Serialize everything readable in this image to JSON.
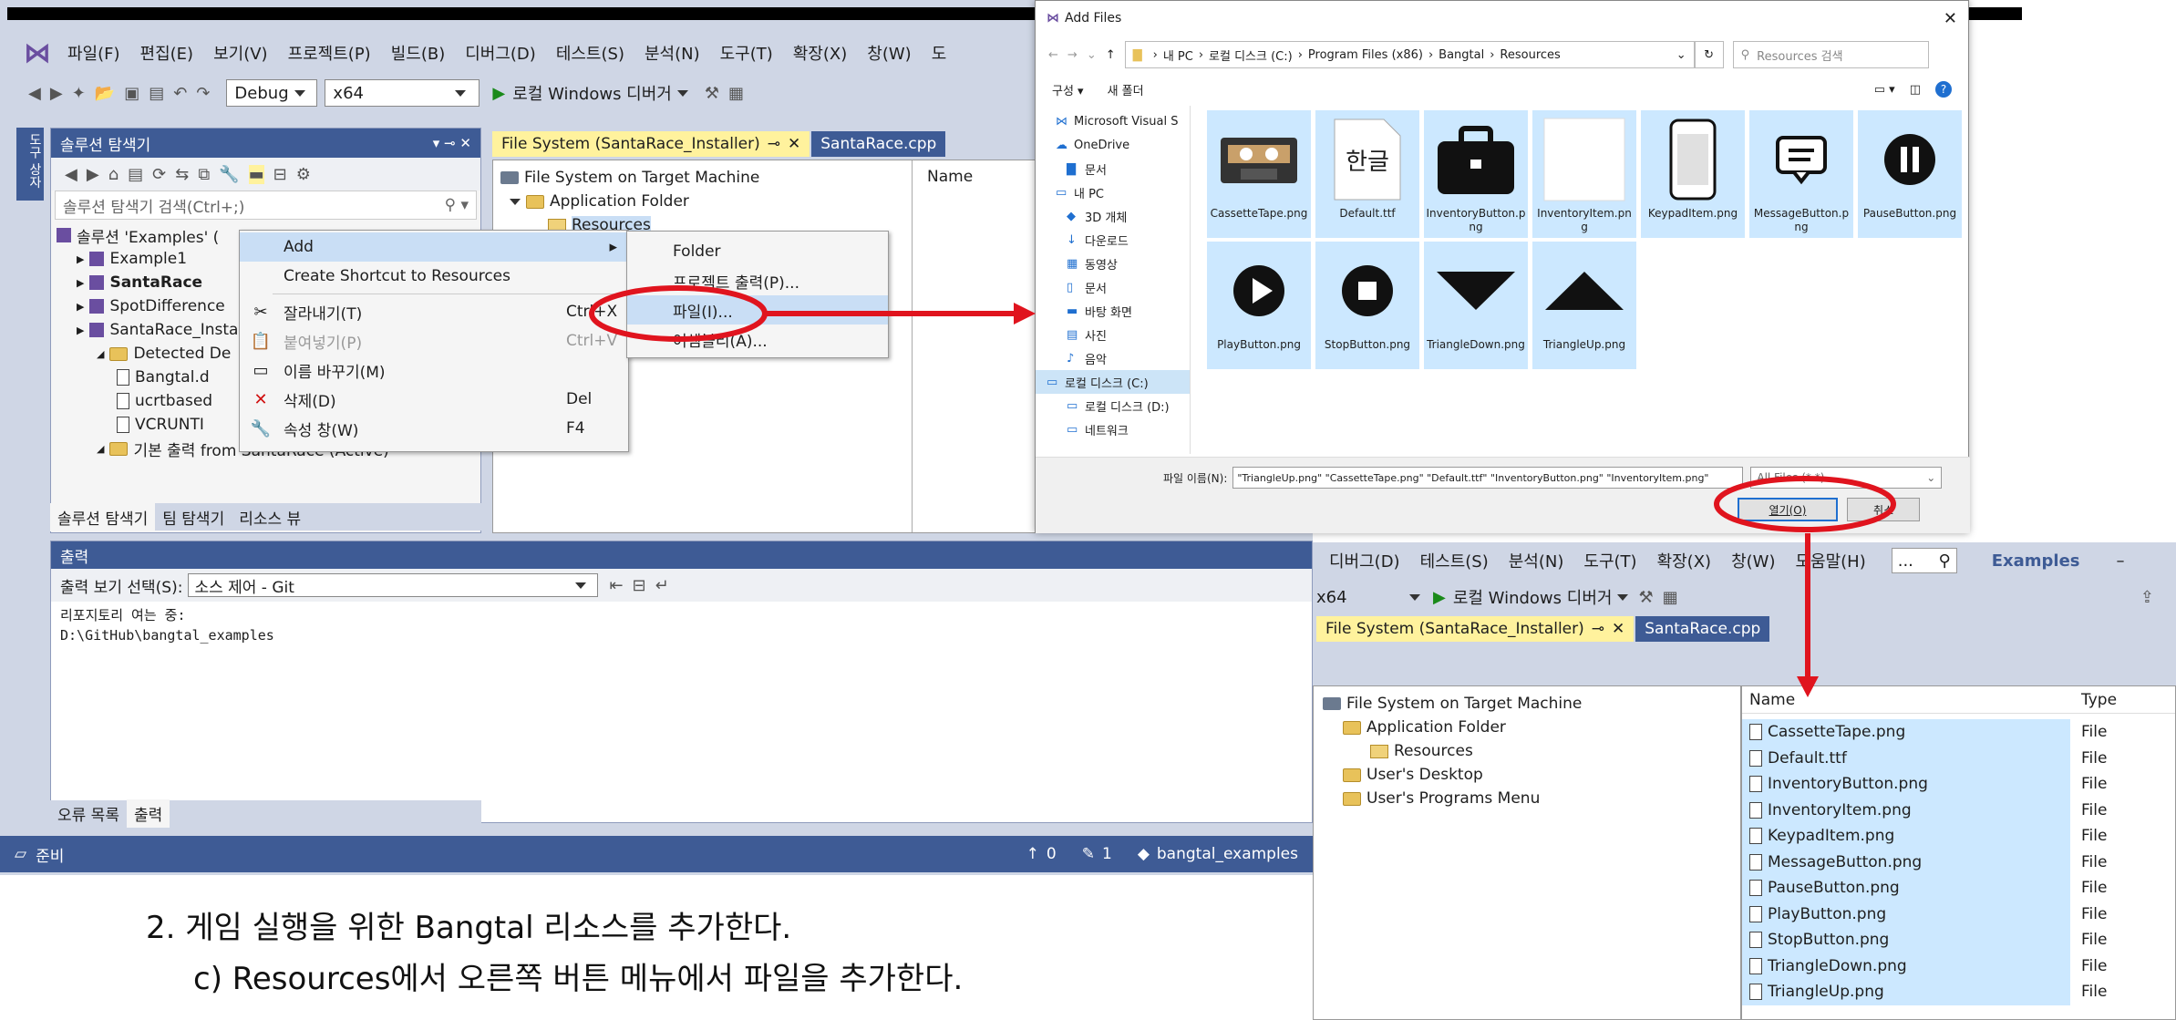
{
  "menubar": {
    "items": [
      "파일(F)",
      "편집(E)",
      "보기(V)",
      "프로젝트(P)",
      "빌드(B)",
      "디버그(D)",
      "테스트(S)",
      "분석(N)",
      "도구(T)",
      "확장(X)",
      "창(W)",
      "도"
    ]
  },
  "toolbar": {
    "config": "Debug",
    "platform": "x64",
    "run_label": "로컬 Windows 디버거"
  },
  "left_vertical_tab": "도구 상자",
  "solution_explorer": {
    "title": "솔루션 탐색기",
    "search_placeholder": "솔루션 탐색기 검색(Ctrl+;)",
    "tree": [
      {
        "label": "솔루션 'Examples' (",
        "indent": 0
      },
      {
        "label": "Example1",
        "indent": 1
      },
      {
        "label": "SantaRace",
        "indent": 1,
        "bold": true
      },
      {
        "label": "SpotDifference",
        "indent": 1
      },
      {
        "label": "SantaRace_Insta",
        "indent": 1
      },
      {
        "label": "Detected De",
        "indent": 2
      },
      {
        "label": "Bangtal.d",
        "indent": 3
      },
      {
        "label": "ucrtbased",
        "indent": 3
      },
      {
        "label": "VCRUNTI",
        "indent": 3
      },
      {
        "label": "기본 출력 from SantaRace (Active)",
        "indent": 2
      }
    ],
    "bottom_tabs": [
      "솔루션 탐색기",
      "팀 탐색기",
      "리소스 뷰"
    ]
  },
  "doc_tabs": {
    "active": "File System (SantaRace_Installer)",
    "pin": "⊸",
    "inactive": "SantaRace.cpp"
  },
  "fs_editor": {
    "tree": [
      "File System on Target Machine",
      "Application Folder",
      "Resources"
    ],
    "list_header": "Name"
  },
  "context_menu": {
    "items": [
      {
        "label": "Add",
        "shortcut": "",
        "icon": "",
        "submenu": true
      },
      {
        "label": "Create Shortcut to Resources",
        "shortcut": "",
        "icon": ""
      },
      {
        "label": "잘라내기(T)",
        "shortcut": "Ctrl+X",
        "icon": "scissors-icon"
      },
      {
        "label": "붙여넣기(P)",
        "shortcut": "Ctrl+V",
        "icon": "paste-icon"
      },
      {
        "label": "이름 바꾸기(M)",
        "shortcut": "",
        "icon": "rename-icon"
      },
      {
        "label": "삭제(D)",
        "shortcut": "Del",
        "icon": "delete-icon"
      },
      {
        "label": "속성 창(W)",
        "shortcut": "F4",
        "icon": "wrench-icon"
      }
    ],
    "submenu": [
      "Folder",
      "프로젝트 출력(P)...",
      "파일(I)...",
      "어셈블리(A)..."
    ]
  },
  "output": {
    "title": "출력",
    "select_label": "출력 보기 선택(S):",
    "select_value": "소스 제어 - Git",
    "lines": [
      "리포지토리 여는 중:",
      "D:\\GitHub\\bangtal_examples"
    ],
    "bottom_tabs": [
      "오류 목록",
      "출력"
    ]
  },
  "statusbar": {
    "left": "준비",
    "up": "0",
    "pencil": "1",
    "repo": "bangtal_examples"
  },
  "caption": {
    "line1": "2. 게임 실행을 위한 Bangtal 리소스를 추가한다.",
    "line2": "c) Resources에서 오른쪽 버튼 메뉴에서 파일을 추가한다."
  },
  "dialog": {
    "title": "Add Files",
    "breadcrumb": [
      "내 PC",
      "로컬 디스크 (C:)",
      "Program Files (x86)",
      "Bangtal",
      "Resources"
    ],
    "search_placeholder": "Resources 검색",
    "cmd_organize": "구성 ▾",
    "cmd_newfolder": "새 폴더",
    "nav": [
      "Microsoft Visual S",
      "OneDrive",
      "문서",
      "내 PC",
      "3D 개체",
      "다운로드",
      "동영상",
      "문서",
      "바탕 화면",
      "사진",
      "음악",
      "로컬 디스크 (C:)",
      "로컬 디스크 (D:)",
      "네트워크"
    ],
    "files": [
      {
        "name": "CassetteTape.png",
        "thumb": "cassette"
      },
      {
        "name": "Default.ttf",
        "thumb": "font",
        "glyph": "한글"
      },
      {
        "name": "InventoryButton.png",
        "thumb": "briefcase"
      },
      {
        "name": "InventoryItem.png",
        "thumb": "blank"
      },
      {
        "name": "KeypadItem.png",
        "thumb": "phone"
      },
      {
        "name": "MessageButton.png",
        "thumb": "message"
      },
      {
        "name": "PauseButton.png",
        "thumb": "pause"
      },
      {
        "name": "PlayButton.png",
        "thumb": "play"
      },
      {
        "name": "StopButton.png",
        "thumb": "stop"
      },
      {
        "name": "TriangleDown.png",
        "thumb": "tri-down"
      },
      {
        "name": "TriangleUp.png",
        "thumb": "tri-up"
      }
    ],
    "filename_label": "파일 이름(N):",
    "filename_value": "\"TriangleUp.png\" \"CassetteTape.png\" \"Default.ttf\" \"InventoryButton.png\" \"InventoryItem.png\"",
    "filetype": "All Files (*.*)",
    "open_btn": "열기(O)",
    "cancel_btn": "취소"
  },
  "vs2": {
    "menu": [
      "디버그(D)",
      "테스트(S)",
      "분석(N)",
      "도구(T)",
      "확장(X)",
      "창(W)",
      "도움말(H)"
    ],
    "search": "...",
    "solution": "Examples",
    "platform": "x64",
    "run_label": "로컬 Windows 디버거",
    "tab_active": "File System (SantaRace_Installer)",
    "tab_inactive": "SantaRace.cpp",
    "tree": [
      "File System on Target Machine",
      "Application Folder",
      "Resources",
      "User's Desktop",
      "User's Programs Menu"
    ],
    "list_headers": [
      "Name",
      "Type"
    ],
    "rows": [
      {
        "name": "CassetteTape.png",
        "type": "File"
      },
      {
        "name": "Default.ttf",
        "type": "File"
      },
      {
        "name": "InventoryButton.png",
        "type": "File"
      },
      {
        "name": "InventoryItem.png",
        "type": "File"
      },
      {
        "name": "KeypadItem.png",
        "type": "File"
      },
      {
        "name": "MessageButton.png",
        "type": "File"
      },
      {
        "name": "PauseButton.png",
        "type": "File"
      },
      {
        "name": "PlayButton.png",
        "type": "File"
      },
      {
        "name": "StopButton.png",
        "type": "File"
      },
      {
        "name": "TriangleDown.png",
        "type": "File"
      },
      {
        "name": "TriangleUp.png",
        "type": "File"
      }
    ]
  },
  "colors": {
    "accent": "#3e5b95",
    "highlight": "#c9def5",
    "annotation": "#e0141e"
  }
}
